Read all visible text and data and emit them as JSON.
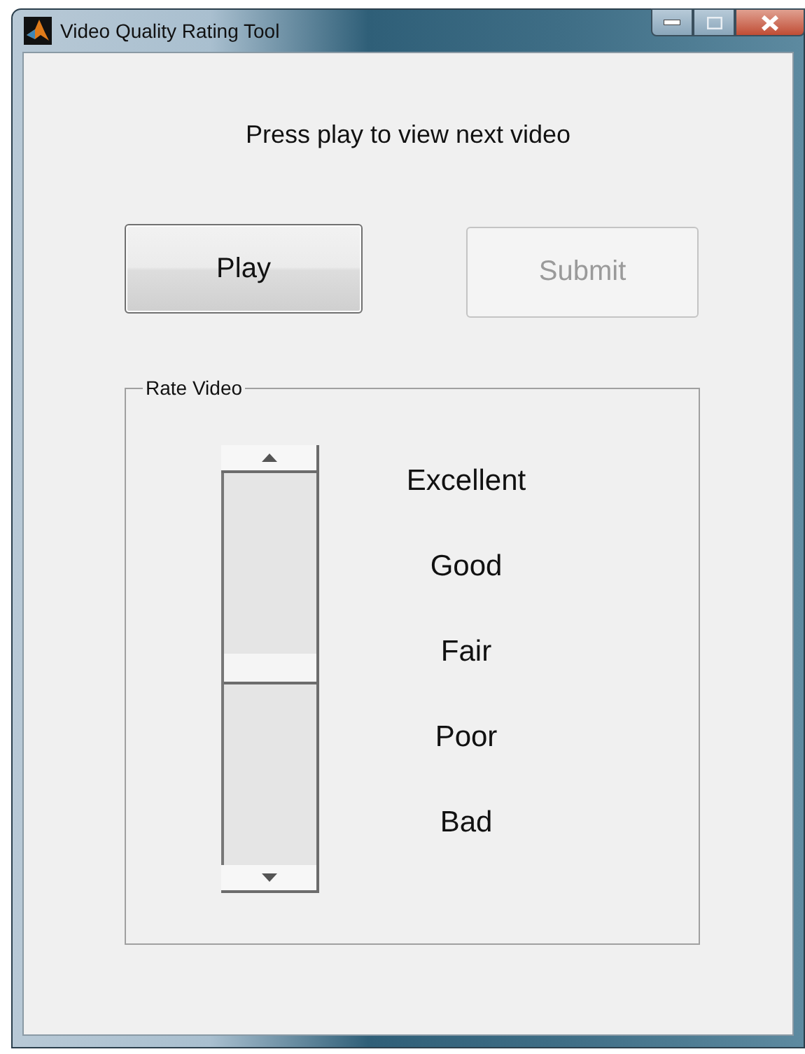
{
  "window": {
    "title": "Video Quality Rating Tool"
  },
  "prompt": "Press play to view next video",
  "buttons": [
    {
      "label": "Play",
      "disabled": false
    },
    {
      "label": "Submit",
      "disabled": true
    }
  ],
  "rating_panel": {
    "title": "Rate Video",
    "slider": {
      "level": 0.5
    },
    "labels": [
      "Excellent",
      "Good",
      "Fair",
      "Poor",
      "Bad"
    ]
  }
}
